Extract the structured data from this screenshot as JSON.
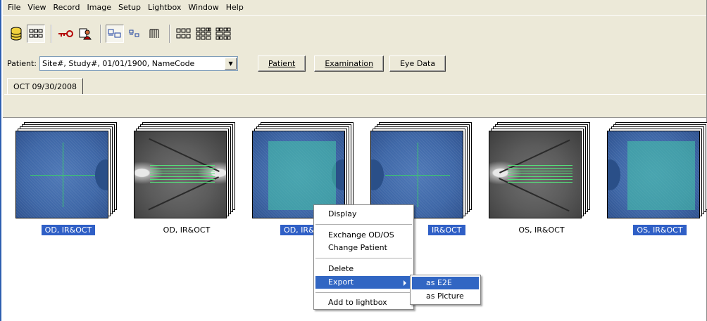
{
  "menubar": {
    "items": [
      "File",
      "View",
      "Record",
      "Image",
      "Setup",
      "Lightbox",
      "Window",
      "Help"
    ]
  },
  "toolbar": {
    "buttons": [
      {
        "icon": "database-icon"
      },
      {
        "icon": "thumbnail-grid-icon",
        "pressed": true
      },
      {
        "icon": "key-icon"
      },
      {
        "icon": "user-card-icon"
      },
      {
        "icon": "single-view-icon",
        "pressed": true
      },
      {
        "icon": "small-view-icon"
      },
      {
        "icon": "list-view-icon"
      },
      {
        "icon": "layout-3x2-icon"
      },
      {
        "icon": "layout-4x2-icon"
      },
      {
        "icon": "layout-4x3-icon"
      }
    ]
  },
  "patient": {
    "label": "Patient:",
    "value": "Site#, Study#, 01/01/1900, NameCode"
  },
  "buttons": {
    "patient": "Patient",
    "examination": "Examination",
    "eye_data": "Eye Data"
  },
  "tabs": [
    {
      "label": "OCT 09/30/2008"
    }
  ],
  "thumbnails": [
    {
      "caption": "OD, IR&OCT",
      "selected": true
    },
    {
      "caption": "OD, IR&OCT",
      "selected": false
    },
    {
      "caption": "OD, IR&OC",
      "selected": true
    },
    {
      "caption": "IR&OCT",
      "selected": true
    },
    {
      "caption": "OS, IR&OCT",
      "selected": false
    },
    {
      "caption": "OS, IR&OCT",
      "selected": true
    }
  ],
  "context_menu": {
    "items": [
      "Display",
      "Exchange OD/OS",
      "Change Patient",
      "Delete",
      "Export",
      "Add to lightbox"
    ],
    "highlighted": "Export"
  },
  "export_submenu": {
    "items": [
      "as E2E",
      "as Picture"
    ],
    "highlighted": "as E2E"
  },
  "colors": {
    "selection": "#2f5fc6",
    "menu_highlight": "#3166c3",
    "chrome": "#ece9d8"
  }
}
